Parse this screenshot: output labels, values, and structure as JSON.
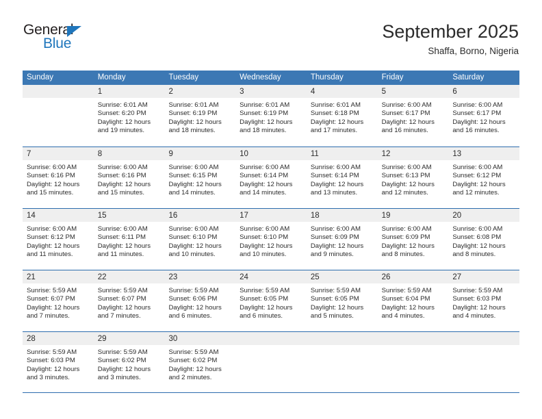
{
  "brand": {
    "name_top": "General",
    "name_bottom": "Blue",
    "triangle_icon": "blue-triangle-icon",
    "color_blue": "#1f76bc",
    "color_black": "#231f20"
  },
  "header": {
    "title": "September 2025",
    "subtitle": "Shaffa, Borno, Nigeria"
  },
  "theme": {
    "header_blue": "#3c78b4",
    "rule_blue": "#2b6cad",
    "daynum_band": "#efefef"
  },
  "calendar": {
    "weekdays": [
      "Sunday",
      "Monday",
      "Tuesday",
      "Wednesday",
      "Thursday",
      "Friday",
      "Saturday"
    ],
    "weeks": [
      [
        {
          "day": "",
          "lines": []
        },
        {
          "day": "1",
          "lines": [
            "Sunrise: 6:01 AM",
            "Sunset: 6:20 PM",
            "Daylight: 12 hours",
            "and 19 minutes."
          ]
        },
        {
          "day": "2",
          "lines": [
            "Sunrise: 6:01 AM",
            "Sunset: 6:19 PM",
            "Daylight: 12 hours",
            "and 18 minutes."
          ]
        },
        {
          "day": "3",
          "lines": [
            "Sunrise: 6:01 AM",
            "Sunset: 6:19 PM",
            "Daylight: 12 hours",
            "and 18 minutes."
          ]
        },
        {
          "day": "4",
          "lines": [
            "Sunrise: 6:01 AM",
            "Sunset: 6:18 PM",
            "Daylight: 12 hours",
            "and 17 minutes."
          ]
        },
        {
          "day": "5",
          "lines": [
            "Sunrise: 6:00 AM",
            "Sunset: 6:17 PM",
            "Daylight: 12 hours",
            "and 16 minutes."
          ]
        },
        {
          "day": "6",
          "lines": [
            "Sunrise: 6:00 AM",
            "Sunset: 6:17 PM",
            "Daylight: 12 hours",
            "and 16 minutes."
          ]
        }
      ],
      [
        {
          "day": "7",
          "lines": [
            "Sunrise: 6:00 AM",
            "Sunset: 6:16 PM",
            "Daylight: 12 hours",
            "and 15 minutes."
          ]
        },
        {
          "day": "8",
          "lines": [
            "Sunrise: 6:00 AM",
            "Sunset: 6:16 PM",
            "Daylight: 12 hours",
            "and 15 minutes."
          ]
        },
        {
          "day": "9",
          "lines": [
            "Sunrise: 6:00 AM",
            "Sunset: 6:15 PM",
            "Daylight: 12 hours",
            "and 14 minutes."
          ]
        },
        {
          "day": "10",
          "lines": [
            "Sunrise: 6:00 AM",
            "Sunset: 6:14 PM",
            "Daylight: 12 hours",
            "and 14 minutes."
          ]
        },
        {
          "day": "11",
          "lines": [
            "Sunrise: 6:00 AM",
            "Sunset: 6:14 PM",
            "Daylight: 12 hours",
            "and 13 minutes."
          ]
        },
        {
          "day": "12",
          "lines": [
            "Sunrise: 6:00 AM",
            "Sunset: 6:13 PM",
            "Daylight: 12 hours",
            "and 12 minutes."
          ]
        },
        {
          "day": "13",
          "lines": [
            "Sunrise: 6:00 AM",
            "Sunset: 6:12 PM",
            "Daylight: 12 hours",
            "and 12 minutes."
          ]
        }
      ],
      [
        {
          "day": "14",
          "lines": [
            "Sunrise: 6:00 AM",
            "Sunset: 6:12 PM",
            "Daylight: 12 hours",
            "and 11 minutes."
          ]
        },
        {
          "day": "15",
          "lines": [
            "Sunrise: 6:00 AM",
            "Sunset: 6:11 PM",
            "Daylight: 12 hours",
            "and 11 minutes."
          ]
        },
        {
          "day": "16",
          "lines": [
            "Sunrise: 6:00 AM",
            "Sunset: 6:10 PM",
            "Daylight: 12 hours",
            "and 10 minutes."
          ]
        },
        {
          "day": "17",
          "lines": [
            "Sunrise: 6:00 AM",
            "Sunset: 6:10 PM",
            "Daylight: 12 hours",
            "and 10 minutes."
          ]
        },
        {
          "day": "18",
          "lines": [
            "Sunrise: 6:00 AM",
            "Sunset: 6:09 PM",
            "Daylight: 12 hours",
            "and 9 minutes."
          ]
        },
        {
          "day": "19",
          "lines": [
            "Sunrise: 6:00 AM",
            "Sunset: 6:09 PM",
            "Daylight: 12 hours",
            "and 8 minutes."
          ]
        },
        {
          "day": "20",
          "lines": [
            "Sunrise: 6:00 AM",
            "Sunset: 6:08 PM",
            "Daylight: 12 hours",
            "and 8 minutes."
          ]
        }
      ],
      [
        {
          "day": "21",
          "lines": [
            "Sunrise: 5:59 AM",
            "Sunset: 6:07 PM",
            "Daylight: 12 hours",
            "and 7 minutes."
          ]
        },
        {
          "day": "22",
          "lines": [
            "Sunrise: 5:59 AM",
            "Sunset: 6:07 PM",
            "Daylight: 12 hours",
            "and 7 minutes."
          ]
        },
        {
          "day": "23",
          "lines": [
            "Sunrise: 5:59 AM",
            "Sunset: 6:06 PM",
            "Daylight: 12 hours",
            "and 6 minutes."
          ]
        },
        {
          "day": "24",
          "lines": [
            "Sunrise: 5:59 AM",
            "Sunset: 6:05 PM",
            "Daylight: 12 hours",
            "and 6 minutes."
          ]
        },
        {
          "day": "25",
          "lines": [
            "Sunrise: 5:59 AM",
            "Sunset: 6:05 PM",
            "Daylight: 12 hours",
            "and 5 minutes."
          ]
        },
        {
          "day": "26",
          "lines": [
            "Sunrise: 5:59 AM",
            "Sunset: 6:04 PM",
            "Daylight: 12 hours",
            "and 4 minutes."
          ]
        },
        {
          "day": "27",
          "lines": [
            "Sunrise: 5:59 AM",
            "Sunset: 6:03 PM",
            "Daylight: 12 hours",
            "and 4 minutes."
          ]
        }
      ],
      [
        {
          "day": "28",
          "lines": [
            "Sunrise: 5:59 AM",
            "Sunset: 6:03 PM",
            "Daylight: 12 hours",
            "and 3 minutes."
          ]
        },
        {
          "day": "29",
          "lines": [
            "Sunrise: 5:59 AM",
            "Sunset: 6:02 PM",
            "Daylight: 12 hours",
            "and 3 minutes."
          ]
        },
        {
          "day": "30",
          "lines": [
            "Sunrise: 5:59 AM",
            "Sunset: 6:02 PM",
            "Daylight: 12 hours",
            "and 2 minutes."
          ]
        },
        {
          "day": "",
          "lines": []
        },
        {
          "day": "",
          "lines": []
        },
        {
          "day": "",
          "lines": []
        },
        {
          "day": "",
          "lines": []
        }
      ]
    ]
  }
}
